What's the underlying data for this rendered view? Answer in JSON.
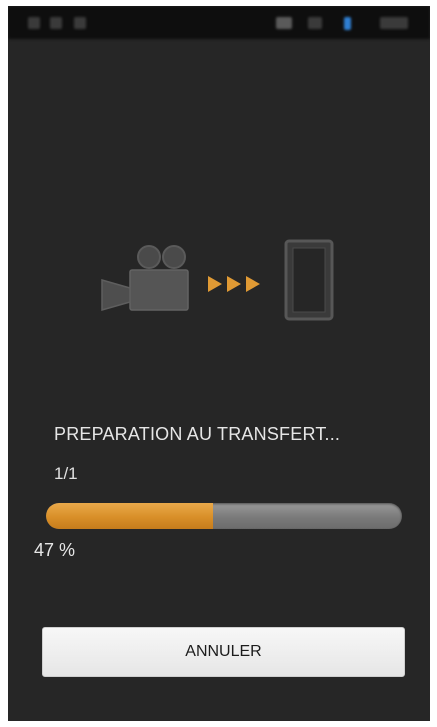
{
  "status_bar": {
    "icons": [
      "notification-icon",
      "notification-icon",
      "notification-icon",
      "wifi-icon",
      "bluetooth-icon",
      "battery-icon"
    ]
  },
  "transfer": {
    "status_text": "PREPARATION AU TRANSFERT...",
    "file_counter": "1/1",
    "progress_fraction": 0.47,
    "percent_label": "47 %"
  },
  "colors": {
    "accent": "#e09a34",
    "background": "#262626",
    "track": "#7a7a7a"
  },
  "icons": {
    "source": "video-camera-icon",
    "direction": "arrows-right-icon",
    "target": "smartphone-icon"
  },
  "actions": {
    "cancel_label": "ANNULER"
  }
}
